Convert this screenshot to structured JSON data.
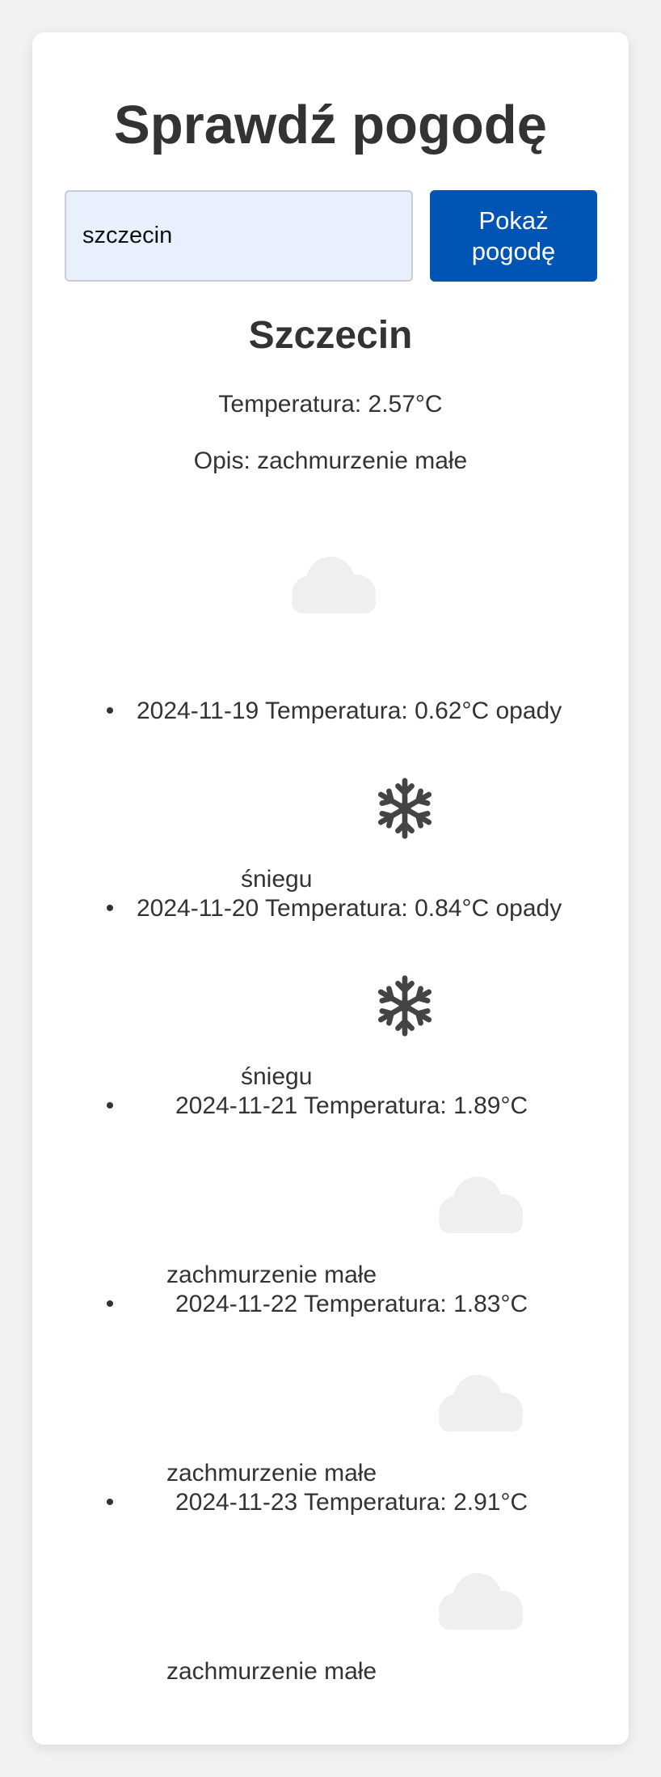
{
  "header": {
    "title": "Sprawdź pogodę"
  },
  "search": {
    "value": "szczecin",
    "button_label": "Pokaż pogodę"
  },
  "current": {
    "city": "Szczecin",
    "temperature": "Temperatura: 2.57°C",
    "description": "Opis: zachmurzenie małe",
    "icon": "cloud-icon"
  },
  "forecast": [
    {
      "line": "2024-11-19 Temperatura: 0.62°C opady",
      "description": "śniegu",
      "icon": "snowflake-icon"
    },
    {
      "line": "2024-11-20 Temperatura: 0.84°C opady",
      "description": "śniegu",
      "icon": "snowflake-icon"
    },
    {
      "line": "2024-11-21 Temperatura: 1.89°C",
      "description": "zachmurzenie małe",
      "icon": "cloud-icon"
    },
    {
      "line": "2024-11-22 Temperatura: 1.83°C",
      "description": "zachmurzenie małe",
      "icon": "cloud-icon"
    },
    {
      "line": "2024-11-23 Temperatura: 2.91°C",
      "description": "zachmurzenie małe",
      "icon": "cloud-icon"
    }
  ],
  "colors": {
    "page_background": "#f1f2f4",
    "card_background": "#ffffff",
    "button": "#0054b4",
    "input_background": "#e8f0fe",
    "text": "#333333",
    "cloud": "#efefef",
    "snowflake": "#444444"
  }
}
